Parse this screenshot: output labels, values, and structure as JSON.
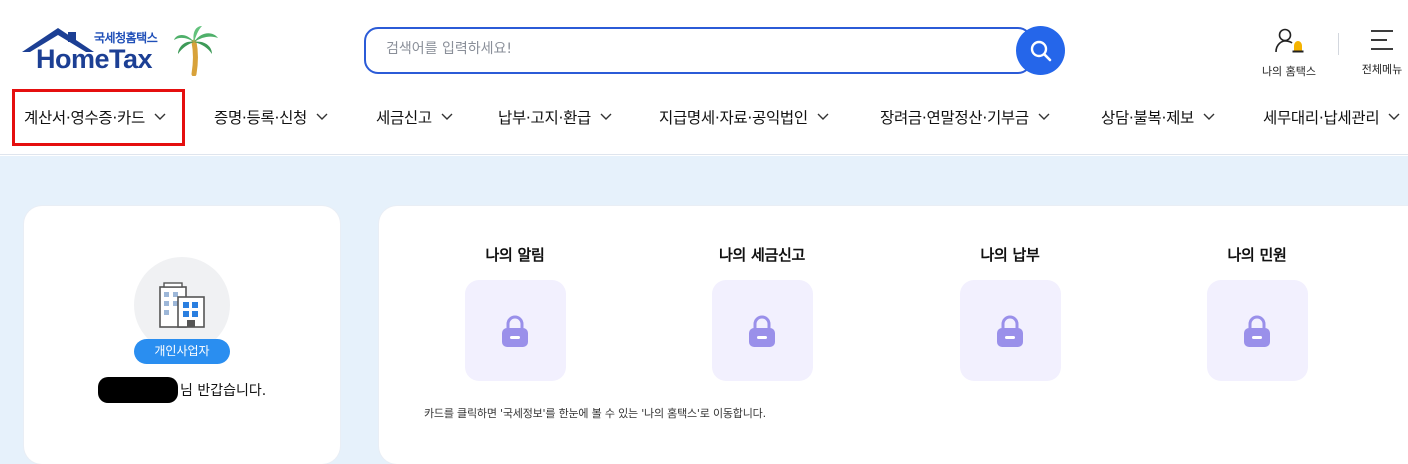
{
  "brand": {
    "subtitle": "국세청홈택스",
    "name": "HomeTax",
    "primary_color": "#1c3f94",
    "accent_color": "#2566ea"
  },
  "search": {
    "placeholder": "검색어를 입력하세요!",
    "value": "",
    "icon": "search-icon"
  },
  "utility": {
    "my_hometax": "나의 홈택스",
    "all_menu": "전체메뉴"
  },
  "nav": {
    "items": [
      {
        "label": "계산서·영수증·카드"
      },
      {
        "label": "증명·등록·신청"
      },
      {
        "label": "세금신고"
      },
      {
        "label": "납부·고지·환급"
      },
      {
        "label": "지급명세·자료·공익법인"
      },
      {
        "label": "장려금·연말정산·기부금"
      },
      {
        "label": "상담·불복·제보"
      },
      {
        "label": "세무대리·납세관리"
      }
    ],
    "highlight_color": "#e50f0f"
  },
  "profile": {
    "type_badge": "개인사업자",
    "greeting": "님 반갑습니다."
  },
  "dashboard": {
    "tiles": [
      {
        "label": "나의 알림",
        "icon": "lock-icon"
      },
      {
        "label": "나의 세금신고",
        "icon": "lock-icon"
      },
      {
        "label": "나의 납부",
        "icon": "lock-icon"
      },
      {
        "label": "나의 민원",
        "icon": "lock-icon"
      }
    ],
    "note": "카드를 클릭하면 '국세정보'를 한눈에 볼 수 있는 '나의 홈택스'로 이동합니다."
  }
}
